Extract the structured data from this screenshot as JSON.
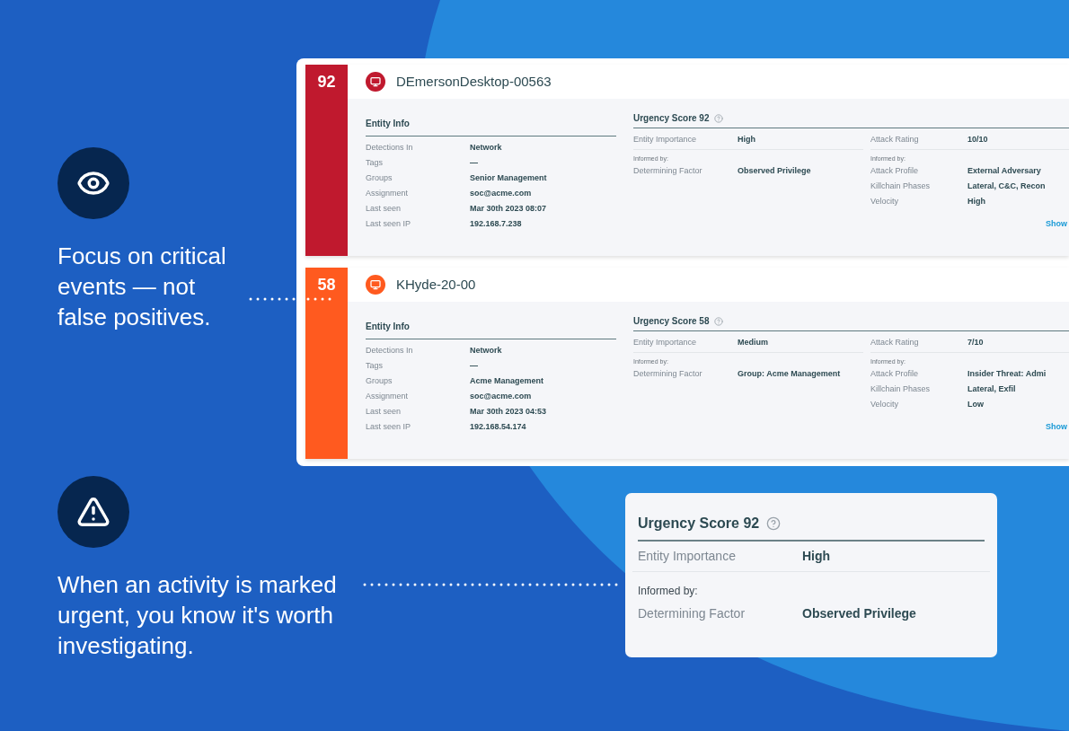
{
  "callouts": [
    {
      "kind": "eye",
      "text": "Focus on critical events — not false positives."
    },
    {
      "kind": "warning",
      "text": "When an activity is marked urgent, you know it's worth investigating."
    }
  ],
  "entities": [
    {
      "score": "92",
      "color": "#c0192e",
      "name": "DEmersonDesktop-00563",
      "info_title": "Entity Info",
      "info_rows": [
        {
          "label": "Detections In",
          "value": "Network"
        },
        {
          "label": "Tags",
          "value": "—"
        },
        {
          "label": "Groups",
          "value": "Senior Management"
        },
        {
          "label": "Assignment",
          "value": "soc@acme.com"
        },
        {
          "label": "Last seen",
          "value": "Mar 30th 2023 08:07"
        },
        {
          "label": "Last seen IP",
          "value": "192.168.7.238"
        }
      ],
      "urgency_title": "Urgency Score 92",
      "importance": {
        "label": "Entity Importance",
        "value": "High"
      },
      "importance_note": "Informed by:",
      "factor": {
        "label": "Determining Factor",
        "value": "Observed Privilege"
      },
      "attack": {
        "label": "Attack Rating",
        "value": "10/10"
      },
      "attack_note": "Informed by:",
      "attack_rows": [
        {
          "label": "Attack Profile",
          "value": "External Adversary"
        },
        {
          "label": "Killchain Phases",
          "value": "Lateral, C&C, Recon"
        },
        {
          "label": "Velocity",
          "value": "High"
        }
      ],
      "link": "Show"
    },
    {
      "score": "58",
      "color": "#ff5a1f",
      "name": "KHyde-20-00",
      "info_title": "Entity Info",
      "info_rows": [
        {
          "label": "Detections In",
          "value": "Network"
        },
        {
          "label": "Tags",
          "value": "—"
        },
        {
          "label": "Groups",
          "value": "Acme Management"
        },
        {
          "label": "Assignment",
          "value": "soc@acme.com"
        },
        {
          "label": "Last seen",
          "value": "Mar 30th 2023 04:53"
        },
        {
          "label": "Last seen IP",
          "value": "192.168.54.174"
        }
      ],
      "urgency_title": "Urgency Score 58",
      "importance": {
        "label": "Entity Importance",
        "value": "Medium"
      },
      "importance_note": "Informed by:",
      "factor": {
        "label": "Determining Factor",
        "value": "Group: Acme Management"
      },
      "attack": {
        "label": "Attack Rating",
        "value": "7/10"
      },
      "attack_note": "Informed by:",
      "attack_rows": [
        {
          "label": "Attack Profile",
          "value": "Insider Threat: Admi"
        },
        {
          "label": "Killchain Phases",
          "value": "Lateral, Exfil"
        },
        {
          "label": "Velocity",
          "value": "Low"
        }
      ],
      "link": "Show"
    }
  ],
  "zoom_card": {
    "title": "Urgency Score 92",
    "importance": {
      "label": "Entity Importance",
      "value": "High"
    },
    "note": "Informed by:",
    "factor": {
      "label": "Determining Factor",
      "value": "Observed Privilege"
    }
  }
}
